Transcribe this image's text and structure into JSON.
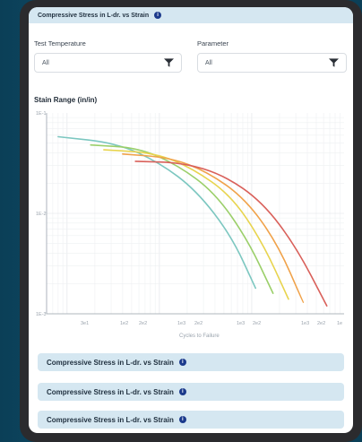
{
  "accordion": {
    "top_label": "Compressive Stress in L-dr. vs Strain",
    "items": [
      {
        "label": "Compressive Stress in L-dr. vs Strain"
      },
      {
        "label": "Compressive Stress in L-dr. vs Strain"
      },
      {
        "label": "Compressive Stress in L-dr. vs Strain"
      }
    ]
  },
  "filters": {
    "temperature": {
      "label": "Test Temperature",
      "value": "All"
    },
    "parameter": {
      "label": "Parameter",
      "value": "All"
    }
  },
  "colors": {
    "accent_bar": "#d5e7f1",
    "info_icon": "#1b3a8c",
    "series": [
      "#7cc7c0",
      "#9bcf6a",
      "#e8d44e",
      "#f0a24a",
      "#d9605a"
    ]
  },
  "chart_data": {
    "type": "line",
    "scale": "log-log",
    "ylabel": "Stain Range (in/in)",
    "xlabel": "Cycles to Failure",
    "y_ticks": [
      "1E-1",
      "1E-2",
      "1E-3"
    ],
    "x_ticks": [
      "3e1",
      "1e2",
      "2e2",
      "1e3",
      "2e2",
      "1e3",
      "2e2",
      "1e3",
      "2e2",
      "1e"
    ],
    "grid": true,
    "series": [
      {
        "color": "#7cc7c0",
        "points": [
          [
            8,
            0.058
          ],
          [
            35,
            0.05
          ],
          [
            100,
            0.032
          ],
          [
            250,
            0.017
          ],
          [
            600,
            0.006
          ],
          [
            1100,
            0.0018
          ]
        ]
      },
      {
        "color": "#9bcf6a",
        "points": [
          [
            18,
            0.048
          ],
          [
            60,
            0.045
          ],
          [
            160,
            0.03
          ],
          [
            400,
            0.016
          ],
          [
            900,
            0.0055
          ],
          [
            1700,
            0.0016
          ]
        ]
      },
      {
        "color": "#e8d44e",
        "points": [
          [
            25,
            0.043
          ],
          [
            90,
            0.04
          ],
          [
            230,
            0.028
          ],
          [
            600,
            0.015
          ],
          [
            1300,
            0.0052
          ],
          [
            2500,
            0.0014
          ]
        ]
      },
      {
        "color": "#f0a24a",
        "points": [
          [
            40,
            0.039
          ],
          [
            130,
            0.036
          ],
          [
            330,
            0.026
          ],
          [
            850,
            0.014
          ],
          [
            1900,
            0.005
          ],
          [
            3600,
            0.0013
          ]
        ]
      },
      {
        "color": "#d9605a",
        "points": [
          [
            55,
            0.033
          ],
          [
            180,
            0.032
          ],
          [
            500,
            0.024
          ],
          [
            1300,
            0.013
          ],
          [
            3000,
            0.0047
          ],
          [
            6500,
            0.0012
          ]
        ]
      }
    ]
  }
}
